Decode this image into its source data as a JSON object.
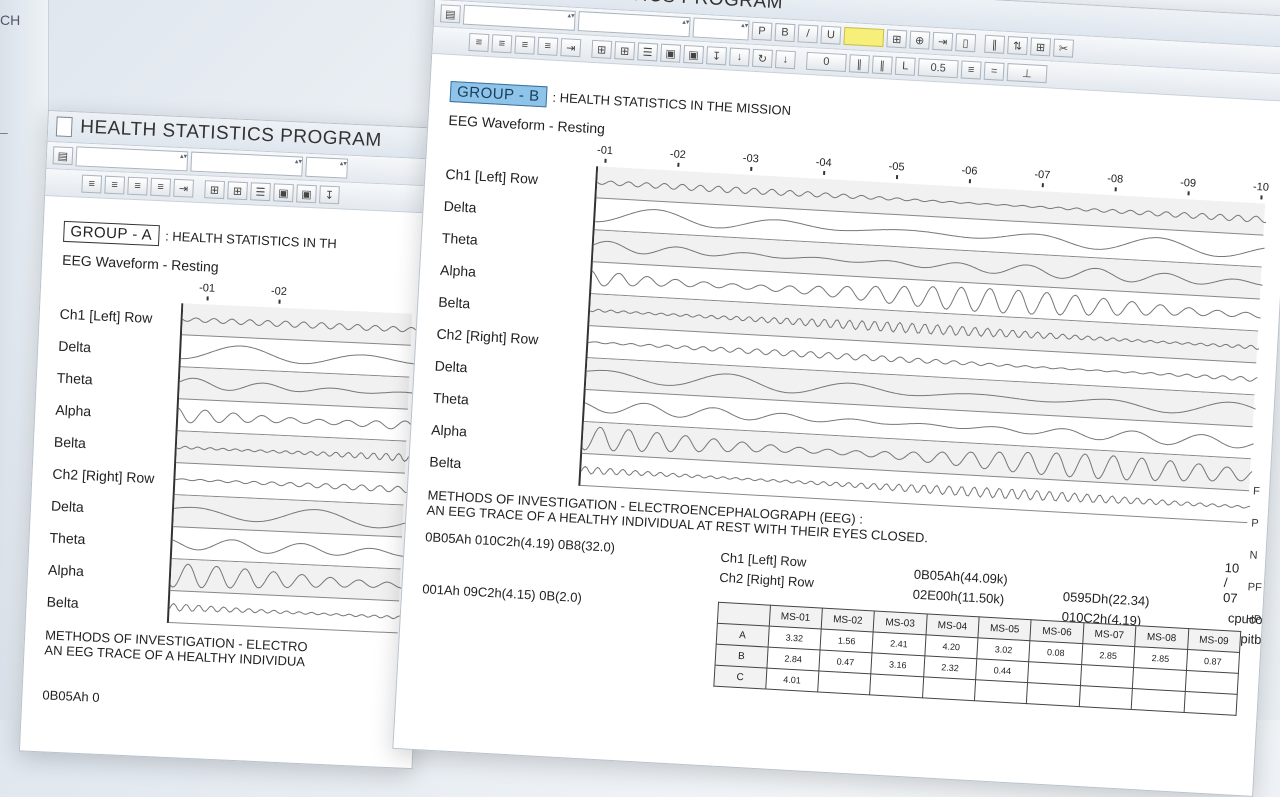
{
  "background": {
    "strip_text": "CH",
    "strip_dash": "–"
  },
  "winA": {
    "title": "HEALTH STATISTICS PROGRAM",
    "group": "GROUP - A",
    "group_desc": ": HEALTH STATISTICS IN TH",
    "subhead": "EEG Waveform - Resting",
    "ticks": [
      "-01",
      "-02"
    ],
    "rows": [
      "Ch1 [Left] Row",
      "Delta",
      "Theta",
      "Alpha",
      "Belta",
      "Ch2 [Right] Row",
      "Delta",
      "Theta",
      "Alpha",
      "Belta"
    ],
    "methods_1": "METHODS OF INVESTIGATION - ELECTRO",
    "methods_2": "AN EEG TRACE OF A HEALTHY INDIVIDUA",
    "footer": "0B05Ah 0"
  },
  "winB": {
    "title": "STATISTICS PROGRAM",
    "group": "GROUP - B",
    "group_desc": ": HEALTH STATISTICS IN THE MISSION",
    "subhead": "EEG Waveform - Resting",
    "ticks": [
      "-01",
      "-02",
      "-03",
      "-04",
      "-05",
      "-06",
      "-07",
      "-08",
      "-09",
      "-10"
    ],
    "rows": [
      "Ch1 [Left] Row",
      "Delta",
      "Theta",
      "Alpha",
      "Belta",
      "Ch2 [Right] Row",
      "Delta",
      "Theta",
      "Alpha",
      "Belta"
    ],
    "toolbar": {
      "p": "P",
      "b": "B",
      "u": "U",
      "zero": "0",
      "l": "L",
      "half": "0.5"
    },
    "methods_1": "METHODS OF INVESTIGATION - ELECTROENCEPHALOGRAPH (EEG) :",
    "methods_2": "AN EEG TRACE OF A HEALTHY INDIVIDUAL AT REST WITH THEIR EYES CLOSED.",
    "hex_left_1": "0B05Ah 010C2h(4.19)  0B8(32.0)",
    "hex_left_2": "001Ah 09C2h(4.15)  0B(2.0)",
    "ch1": "Ch1 [Left] Row",
    "ch2": "Ch2 [Right] Row",
    "val_1": "0B05Ah(44.09k)",
    "val_2": "02E00h(11.50k)",
    "val_3": "0595Dh(22.34)",
    "val_4": "010C2h(4.19)",
    "val_5": "cpuco",
    "val_6": "acpitbl",
    "page": "10 / 07",
    "side_labels": [
      "F",
      "P",
      "N",
      "PF",
      "HP"
    ],
    "table": {
      "headers": [
        "MS-01",
        "MS-02",
        "MS-03",
        "MS-04",
        "MS-05",
        "MS-06",
        "MS-07",
        "MS-08",
        "MS-09"
      ],
      "rows": [
        {
          "label": "A",
          "values": [
            "3.32",
            "1.56",
            "2.41",
            "4.20",
            "3.02",
            "0.08",
            "2.85",
            "2.85",
            "0.87"
          ]
        },
        {
          "label": "B",
          "values": [
            "2.84",
            "0.47",
            "3.16",
            "2.32",
            "0.44",
            "",
            "",
            "",
            ""
          ]
        },
        {
          "label": "C",
          "values": [
            "4.01",
            "",
            "",
            "",
            "",
            "",
            "",
            "",
            ""
          ]
        }
      ]
    }
  }
}
